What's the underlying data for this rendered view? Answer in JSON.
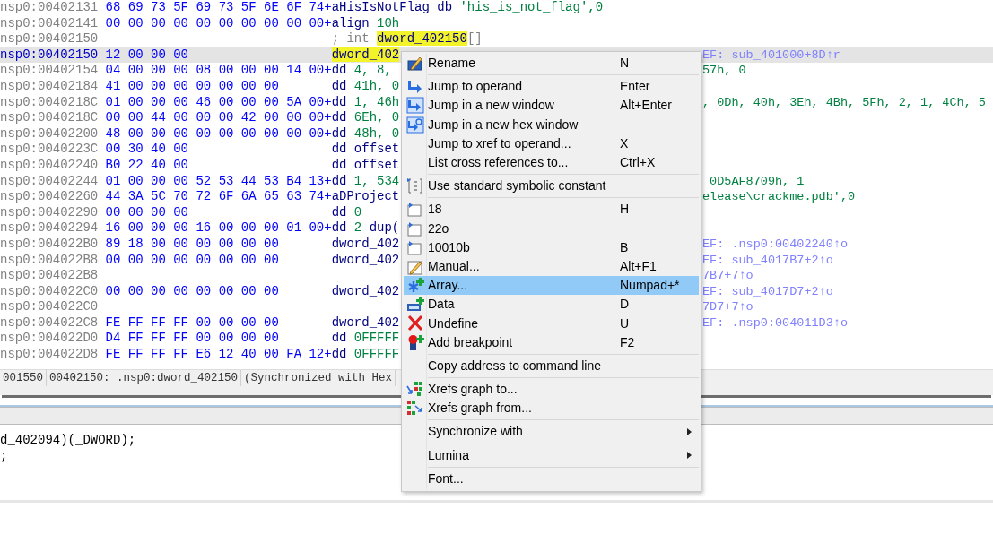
{
  "listing": {
    "rows": [
      {
        "address": "nsp0:00402131",
        "bytes": "68 69 73 5F 69 73 5F 6E 6F 74+",
        "code": [
          {
            "text": "aHisIsNotFlag db ",
            "kind": "name"
          },
          {
            "text": "'his_is_not_flag',0",
            "kind": "number"
          }
        ],
        "selected": false
      },
      {
        "address": "nsp0:00402141",
        "bytes": "00 00 00 00 00 00 00 00 00 00+",
        "code": [
          {
            "text": "align ",
            "kind": "name"
          },
          {
            "text": "10h",
            "kind": "number"
          }
        ],
        "selected": false
      },
      {
        "address": "nsp0:00402150",
        "code": [
          {
            "text": "; int ",
            "kind": "comment"
          },
          {
            "text": "dword_402150",
            "kind": "symbol"
          },
          {
            "text": "[]",
            "kind": "comment"
          }
        ],
        "selected": false
      },
      {
        "address": "nsp0:00402150",
        "bytes": "12 00 00 00",
        "code": [
          {
            "text": "dword_402",
            "kind": "symbol"
          }
        ],
        "right": [
          {
            "text": "EF: sub_401000+8D↑r",
            "kind": "xref"
          }
        ],
        "selected": true
      },
      {
        "address": "nsp0:00402154",
        "bytes": "04 00 00 00 08 00 00 00 14 00+",
        "code": [
          {
            "text": "dd ",
            "kind": "name"
          },
          {
            "text": "4, 8,",
            "kind": "number"
          }
        ],
        "right": [
          {
            "text": "57h, 0",
            "kind": "number"
          }
        ],
        "selected": false
      },
      {
        "address": "nsp0:00402184",
        "bytes": "41 00 00 00 00 00 00 00",
        "code": [
          {
            "text": "dd ",
            "kind": "name"
          },
          {
            "text": "41h, 0",
            "kind": "number"
          }
        ],
        "selected": false
      },
      {
        "address": "nsp0:0040218C",
        "bytes": "01 00 00 00 46 00 00 00 5A 00+",
        "code": [
          {
            "text": "dd ",
            "kind": "name"
          },
          {
            "text": "1, 46h",
            "kind": "number"
          }
        ],
        "right": [
          {
            "text": ", 0Dh, 40h, 3Eh, 4Bh, 5Fh, 2, 1, 4Ch, 5",
            "kind": "number"
          }
        ],
        "selected": false
      },
      {
        "address": "nsp0:0040218C",
        "bytes": "00 00 44 00 00 00 42 00 00 00+",
        "code": [
          {
            "text": "dd ",
            "kind": "name"
          },
          {
            "text": "6Eh, 0",
            "kind": "number"
          }
        ],
        "selected": false
      },
      {
        "address": "nsp0:00402200",
        "bytes": "48 00 00 00 00 00 00 00 00 00+",
        "code": [
          {
            "text": "dd ",
            "kind": "name"
          },
          {
            "text": "48h, 0",
            "kind": "number"
          }
        ],
        "selected": false
      },
      {
        "address": "nsp0:0040223C",
        "bytes": "00 30 40 00",
        "code": [
          {
            "text": "dd offset",
            "kind": "name"
          }
        ],
        "selected": false
      },
      {
        "address": "nsp0:00402240",
        "bytes": "B0 22 40 00",
        "code": [
          {
            "text": "dd offset",
            "kind": "name"
          }
        ],
        "selected": false
      },
      {
        "address": "nsp0:00402244",
        "bytes": "01 00 00 00 52 53 44 53 B4 13+",
        "code": [
          {
            "text": "dd ",
            "kind": "name"
          },
          {
            "text": "1, 534",
            "kind": "number"
          }
        ],
        "right": [
          {
            "text": " 0D5AF8709h, 1",
            "kind": "number"
          }
        ],
        "selected": false
      },
      {
        "address": "nsp0:00402260",
        "bytes": "44 3A 5C 70 72 6F 6A 65 63 74+",
        "code": [
          {
            "text": "aDProject",
            "kind": "name"
          }
        ],
        "right": [
          {
            "text": "elease\\crackme.pdb',0",
            "kind": "number"
          }
        ],
        "selected": false
      },
      {
        "address": "nsp0:00402290",
        "bytes": "00 00 00 00",
        "code": [
          {
            "text": "dd ",
            "kind": "name"
          },
          {
            "text": "0",
            "kind": "number"
          }
        ],
        "selected": false
      },
      {
        "address": "nsp0:00402294",
        "bytes": "16 00 00 00 16 00 00 00 01 00+",
        "code": [
          {
            "text": "dd ",
            "kind": "name"
          },
          {
            "text": "2",
            "kind": "number"
          },
          {
            "text": " dup(",
            "kind": "name"
          }
        ],
        "selected": false
      },
      {
        "address": "nsp0:004022B0",
        "bytes": "89 18 00 00 00 00 00 00",
        "code": [
          {
            "text": "dword_402",
            "kind": "name"
          }
        ],
        "right": [
          {
            "text": "EF: .nsp0:00402240↑o",
            "kind": "xref"
          }
        ],
        "selected": false
      },
      {
        "address": "nsp0:004022B8",
        "bytes": "00 00 00 00 00 00 00 00",
        "code": [
          {
            "text": "dword_402",
            "kind": "name"
          }
        ],
        "right": [
          {
            "text": "EF: sub_4017B7+2↑o",
            "kind": "xref"
          }
        ],
        "selected": false
      },
      {
        "address": "nsp0:004022B8",
        "right": [
          {
            "text": "7B7+7↑o",
            "kind": "xref"
          }
        ],
        "selected": false
      },
      {
        "address": "nsp0:004022C0",
        "bytes": "00 00 00 00 00 00 00 00",
        "code": [
          {
            "text": "dword_402",
            "kind": "name"
          }
        ],
        "right": [
          {
            "text": "EF: sub_4017D7+2↑o",
            "kind": "xref"
          }
        ],
        "selected": false
      },
      {
        "address": "nsp0:004022C0",
        "right": [
          {
            "text": "7D7+7↑o",
            "kind": "xref"
          }
        ],
        "selected": false
      },
      {
        "address": "nsp0:004022C8",
        "bytes": "FE FF FF FF 00 00 00 00",
        "code": [
          {
            "text": "dword_402",
            "kind": "name"
          }
        ],
        "right": [
          {
            "text": "EF: .nsp0:004011D3↑o",
            "kind": "xref"
          }
        ],
        "selected": false
      },
      {
        "address": "nsp0:004022D0",
        "bytes": "D4 FF FF FF 00 00 00 00",
        "code": [
          {
            "text": "dd ",
            "kind": "name"
          },
          {
            "text": "0FFFFF",
            "kind": "number"
          }
        ],
        "selected": false
      },
      {
        "address": "nsp0:004022D8",
        "bytes": "FE FF FF FF E6 12 40 00 FA 12+",
        "code": [
          {
            "text": "dd ",
            "kind": "name"
          },
          {
            "text": "0FFFFF",
            "kind": "number"
          }
        ],
        "selected": false
      }
    ]
  },
  "status_bar": [
    "001550",
    "00402150: .nsp0:dword_402150",
    "(Synchronized with Hex"
  ],
  "pseudocode": {
    "lines": [
      "d_402094)(_DWORD);",
      ";"
    ]
  },
  "context_menu": [
    {
      "kind": "item",
      "label": "Rename",
      "shortcut": "N",
      "selected": false
    },
    {
      "kind": "separator"
    },
    {
      "kind": "item",
      "label": "Jump to operand",
      "shortcut": "Enter",
      "selected": false
    },
    {
      "kind": "item",
      "label": "Jump in a new window",
      "shortcut": "Alt+Enter",
      "selected": false
    },
    {
      "kind": "item",
      "label": "Jump in a new hex window",
      "selected": false
    },
    {
      "kind": "item",
      "label": "Jump to xref to operand...",
      "shortcut": "X",
      "selected": false
    },
    {
      "kind": "item",
      "label": "List cross references to...",
      "shortcut": "Ctrl+X",
      "selected": false
    },
    {
      "kind": "separator"
    },
    {
      "kind": "item",
      "label": "Use standard symbolic constant",
      "selected": false
    },
    {
      "kind": "separator"
    },
    {
      "kind": "item",
      "label": "18",
      "shortcut": "H",
      "selected": false
    },
    {
      "kind": "item",
      "label": "22o",
      "selected": false
    },
    {
      "kind": "item",
      "label": "10010b",
      "shortcut": "B",
      "selected": false
    },
    {
      "kind": "item",
      "label": "Manual...",
      "shortcut": "Alt+F1",
      "selected": false
    },
    {
      "kind": "item",
      "label": "Array...",
      "shortcut": "Numpad+*",
      "selected": true
    },
    {
      "kind": "item",
      "label": "Data",
      "shortcut": "D",
      "selected": false
    },
    {
      "kind": "item",
      "label": "Undefine",
      "shortcut": "U",
      "selected": false
    },
    {
      "kind": "item",
      "label": "Add breakpoint",
      "shortcut": "F2",
      "selected": false
    },
    {
      "kind": "separator"
    },
    {
      "kind": "item",
      "label": "Copy address to command line",
      "selected": false
    },
    {
      "kind": "separator"
    },
    {
      "kind": "item",
      "label": "Xrefs graph to...",
      "selected": false
    },
    {
      "kind": "item",
      "label": "Xrefs graph from...",
      "selected": false
    },
    {
      "kind": "separator"
    },
    {
      "kind": "submenu",
      "label": "Synchronize with",
      "selected": false
    },
    {
      "kind": "separator"
    },
    {
      "kind": "submenu",
      "label": "Lumina",
      "selected": false
    },
    {
      "kind": "separator"
    },
    {
      "kind": "item",
      "label": "Font...",
      "selected": false
    }
  ]
}
